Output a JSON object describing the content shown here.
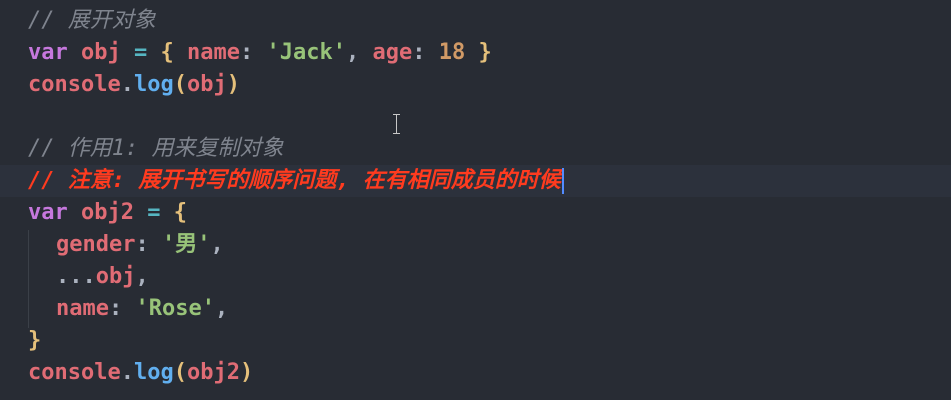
{
  "editor": {
    "lines": [
      {
        "kind": "comment",
        "text": "// 展开对象"
      },
      {
        "kind": "code",
        "tokens": [
          {
            "t": "var",
            "c": "kw"
          },
          {
            "t": " ",
            "c": "pl"
          },
          {
            "t": "obj",
            "c": "var"
          },
          {
            "t": " ",
            "c": "pl"
          },
          {
            "t": "=",
            "c": "op"
          },
          {
            "t": " ",
            "c": "pl"
          },
          {
            "t": "{",
            "c": "br"
          },
          {
            "t": " ",
            "c": "pl"
          },
          {
            "t": "name",
            "c": "prop"
          },
          {
            "t": ":",
            "c": "pun"
          },
          {
            "t": " ",
            "c": "pl"
          },
          {
            "t": "'Jack'",
            "c": "str"
          },
          {
            "t": ",",
            "c": "pun"
          },
          {
            "t": " ",
            "c": "pl"
          },
          {
            "t": "age",
            "c": "prop"
          },
          {
            "t": ":",
            "c": "pun"
          },
          {
            "t": " ",
            "c": "pl"
          },
          {
            "t": "18",
            "c": "num"
          },
          {
            "t": " ",
            "c": "pl"
          },
          {
            "t": "}",
            "c": "br"
          }
        ]
      },
      {
        "kind": "code",
        "tokens": [
          {
            "t": "console",
            "c": "var"
          },
          {
            "t": ".",
            "c": "pun"
          },
          {
            "t": "log",
            "c": "fn"
          },
          {
            "t": "(",
            "c": "br"
          },
          {
            "t": "obj",
            "c": "var"
          },
          {
            "t": ")",
            "c": "br"
          }
        ]
      },
      {
        "kind": "blank"
      },
      {
        "kind": "comment",
        "text": "// 作用1: 用来复制对象"
      },
      {
        "kind": "comment-hl",
        "text": "// 注意: 展开书写的顺序问题, 在有相同成员的时候"
      },
      {
        "kind": "code",
        "tokens": [
          {
            "t": "var",
            "c": "kw"
          },
          {
            "t": " ",
            "c": "pl"
          },
          {
            "t": "obj2",
            "c": "var"
          },
          {
            "t": " ",
            "c": "pl"
          },
          {
            "t": "=",
            "c": "op"
          },
          {
            "t": " ",
            "c": "pl"
          },
          {
            "t": "{",
            "c": "br"
          }
        ]
      },
      {
        "kind": "code",
        "indent": true,
        "tokens": [
          {
            "t": "gender",
            "c": "prop"
          },
          {
            "t": ":",
            "c": "pun"
          },
          {
            "t": " ",
            "c": "pl"
          },
          {
            "t": "'男'",
            "c": "str"
          },
          {
            "t": ",",
            "c": "pun"
          }
        ]
      },
      {
        "kind": "code",
        "indent": true,
        "tokens": [
          {
            "t": "...",
            "c": "pun"
          },
          {
            "t": "obj",
            "c": "var"
          },
          {
            "t": ",",
            "c": "pun"
          }
        ]
      },
      {
        "kind": "code",
        "indent": true,
        "tokens": [
          {
            "t": "name",
            "c": "prop"
          },
          {
            "t": ":",
            "c": "pun"
          },
          {
            "t": " ",
            "c": "pl"
          },
          {
            "t": "'Rose'",
            "c": "str"
          },
          {
            "t": ",",
            "c": "pun"
          }
        ]
      },
      {
        "kind": "code",
        "tokens": [
          {
            "t": "}",
            "c": "br"
          }
        ]
      },
      {
        "kind": "code",
        "tokens": [
          {
            "t": "console",
            "c": "var"
          },
          {
            "t": ".",
            "c": "pun"
          },
          {
            "t": "log",
            "c": "fn"
          },
          {
            "t": "(",
            "c": "br"
          },
          {
            "t": "obj2",
            "c": "var"
          },
          {
            "t": ")",
            "c": "br"
          }
        ]
      }
    ]
  },
  "colors": {
    "background": "#282c34",
    "keyword": "#c678dd",
    "variable": "#e06c75",
    "string": "#98c379",
    "number": "#d19a66",
    "function": "#61afef",
    "bracket": "#e5c07b",
    "comment": "#7f848e",
    "comment_highlight": "#ff3b1f"
  }
}
